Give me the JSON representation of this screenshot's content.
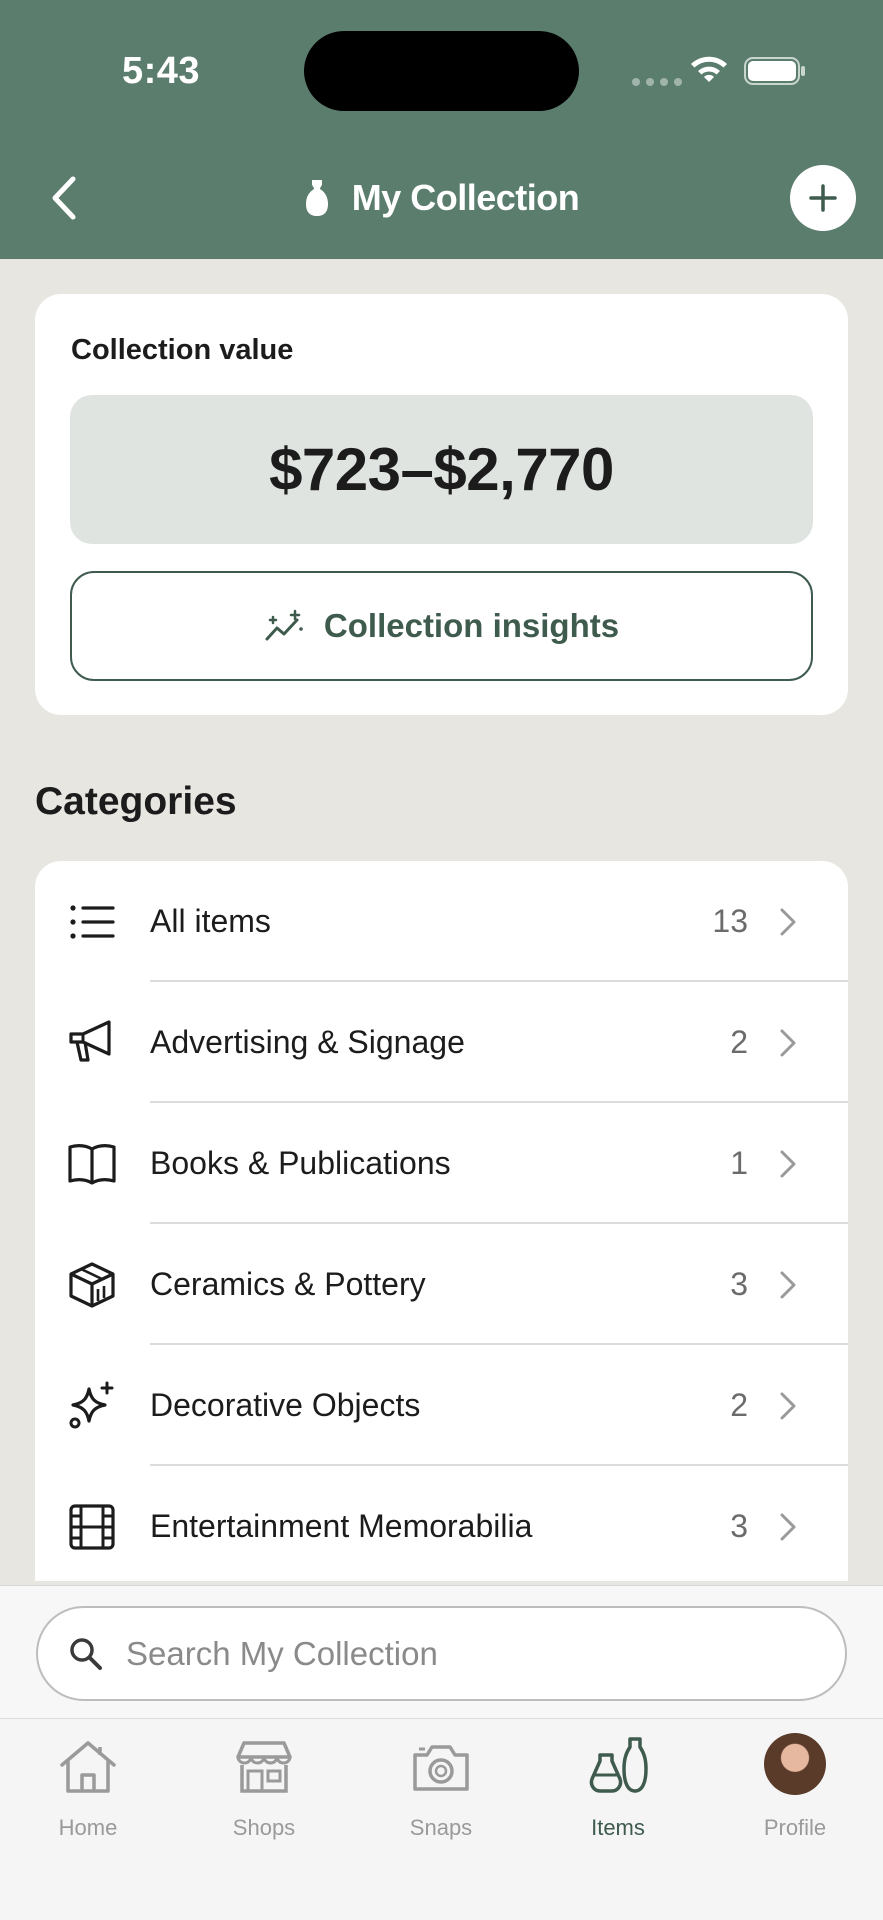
{
  "status_bar": {
    "time": "5:43"
  },
  "header": {
    "title": "My Collection"
  },
  "value_card": {
    "label": "Collection value",
    "amount": "$723–$2,770",
    "insights_label": "Collection insights"
  },
  "categories": {
    "heading": "Categories",
    "items": [
      {
        "label": "All items",
        "count": "13",
        "icon": "list-icon"
      },
      {
        "label": "Advertising & Signage",
        "count": "2",
        "icon": "megaphone-icon"
      },
      {
        "label": "Books & Publications",
        "count": "1",
        "icon": "book-icon"
      },
      {
        "label": "Ceramics & Pottery",
        "count": "3",
        "icon": "cube-icon"
      },
      {
        "label": "Decorative Objects",
        "count": "2",
        "icon": "sparkles-icon"
      },
      {
        "label": "Entertainment Memorabilia",
        "count": "3",
        "icon": "film-icon"
      }
    ]
  },
  "search": {
    "placeholder": "Search My Collection"
  },
  "tabbar": {
    "tabs": [
      {
        "label": "Home",
        "icon": "home-icon"
      },
      {
        "label": "Shops",
        "icon": "shop-icon"
      },
      {
        "label": "Snaps",
        "icon": "camera-icon"
      },
      {
        "label": "Items",
        "icon": "vases-icon",
        "active": true
      },
      {
        "label": "Profile",
        "icon": "avatar"
      }
    ]
  },
  "colors": {
    "header_bg": "#5b7d6e",
    "accent": "#3e5b4e",
    "page_bg": "#e8e6e1"
  }
}
